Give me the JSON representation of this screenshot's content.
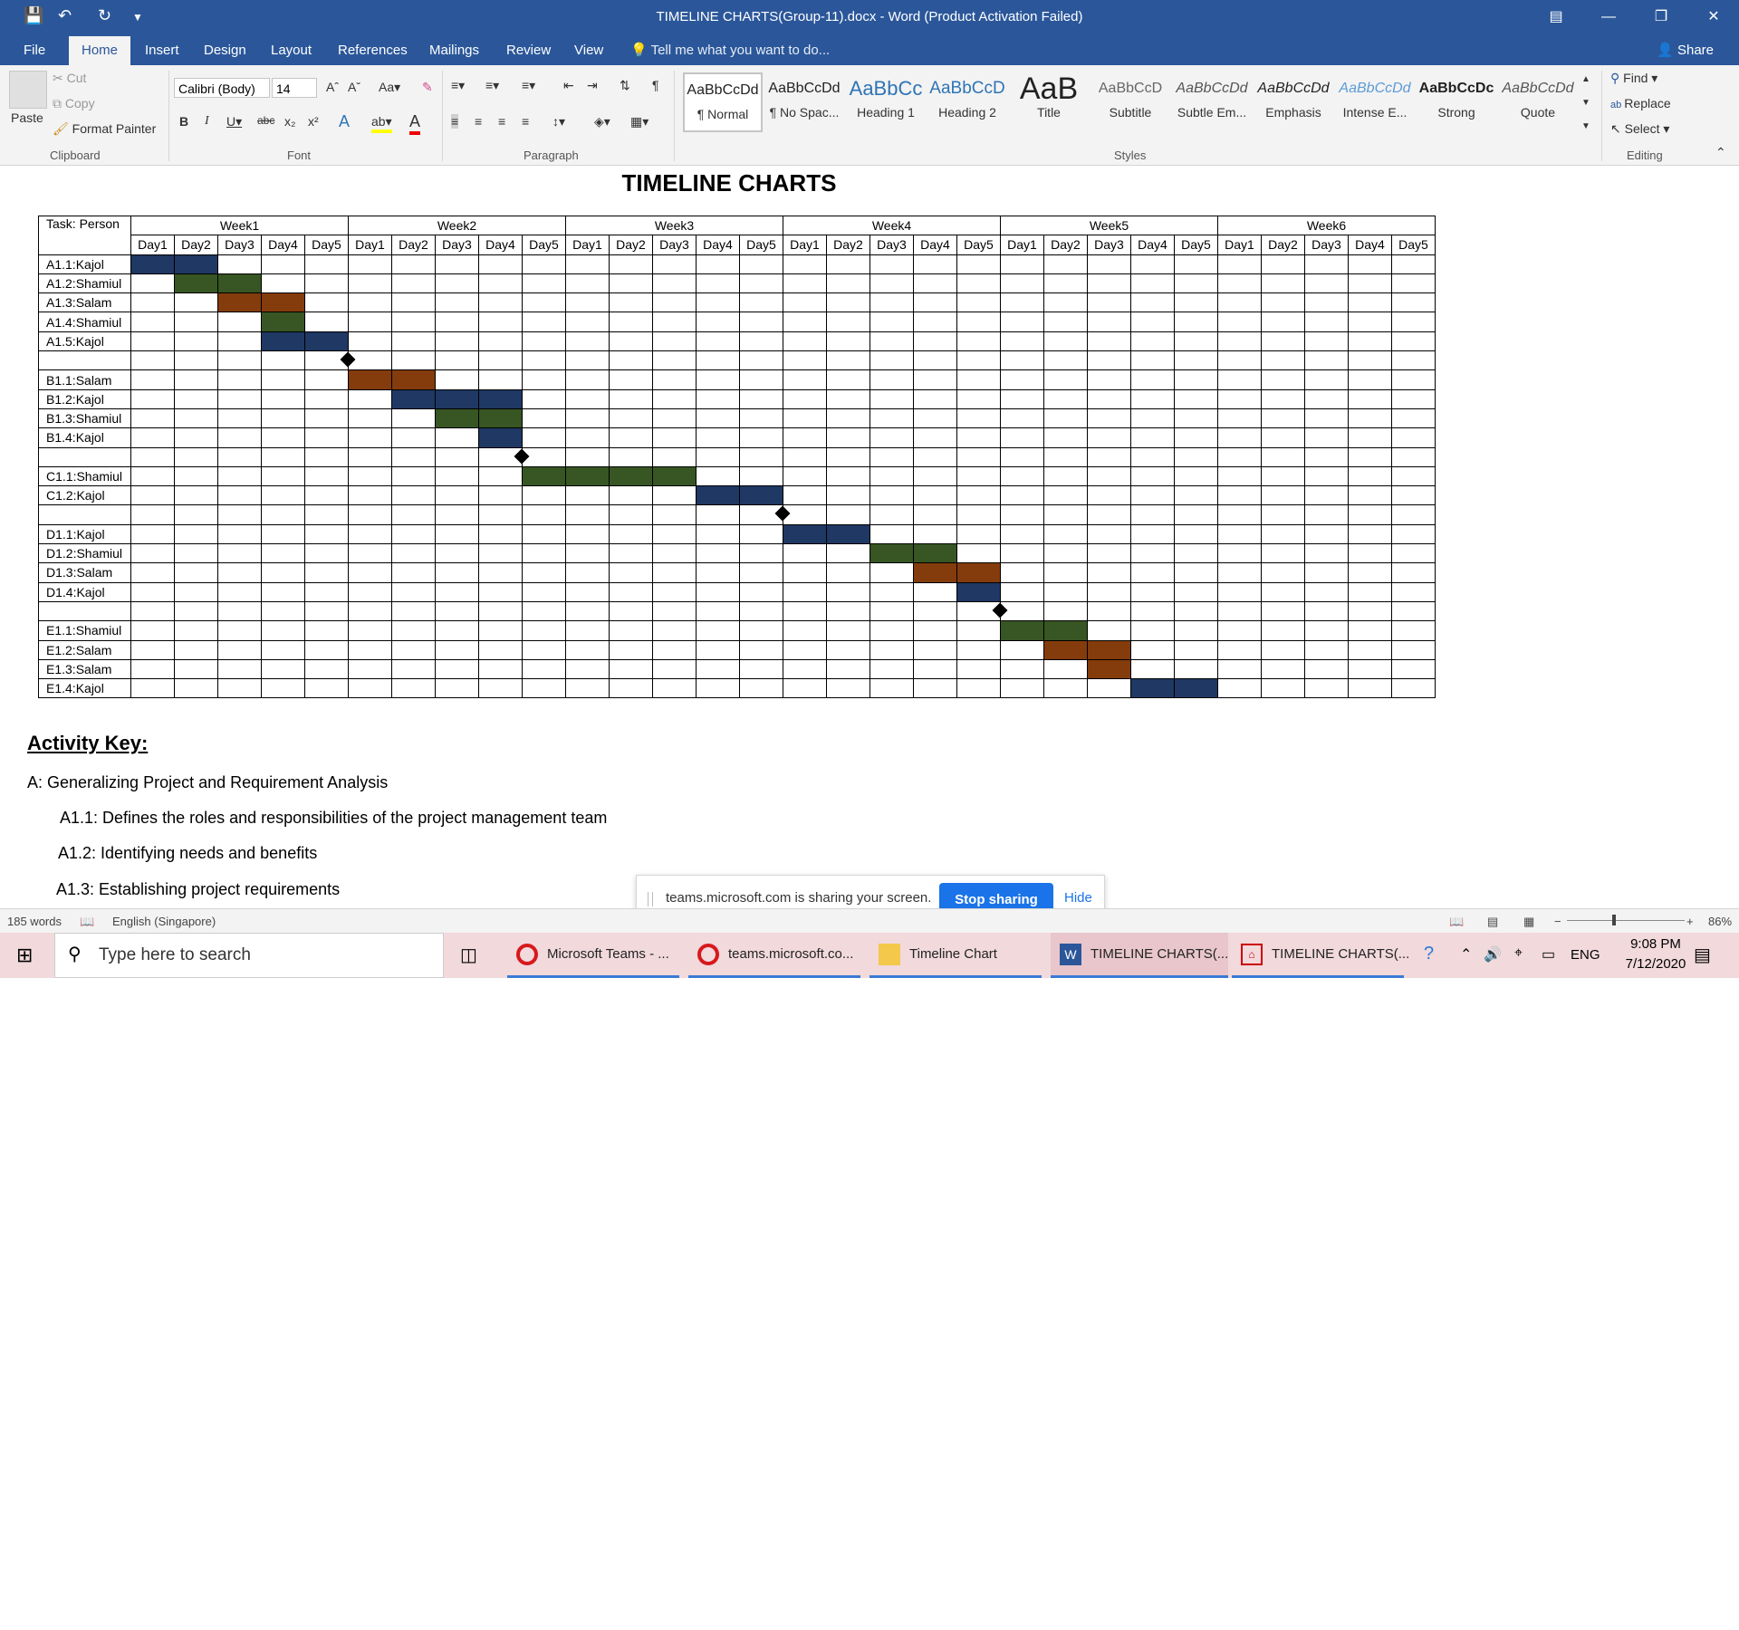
{
  "window": {
    "title": "TIMELINE CHARTS(Group-11).docx - Word (Product Activation Failed)"
  },
  "tabs": [
    "File",
    "Home",
    "Insert",
    "Design",
    "Layout",
    "References",
    "Mailings",
    "Review",
    "View"
  ],
  "tell_me": "Tell me what you want to do...",
  "share": "Share",
  "clipboard": {
    "paste": "Paste",
    "cut": "Cut",
    "copy": "Copy",
    "format_painter": "Format Painter",
    "label": "Clipboard"
  },
  "font": {
    "name": "Calibri (Body)",
    "size": "14",
    "label": "Font"
  },
  "paragraph": {
    "label": "Paragraph"
  },
  "styles": {
    "label": "Styles",
    "items": [
      {
        "preview": "AaBbCcDd",
        "name": "¶ Normal"
      },
      {
        "preview": "AaBbCcDd",
        "name": "¶ No Spac..."
      },
      {
        "preview": "AaBbCc",
        "name": "Heading 1"
      },
      {
        "preview": "AaBbCcD",
        "name": "Heading 2"
      },
      {
        "preview": "AaB",
        "name": "Title"
      },
      {
        "preview": "AaBbCcD",
        "name": "Subtitle"
      },
      {
        "preview": "AaBbCcDd",
        "name": "Subtle Em..."
      },
      {
        "preview": "AaBbCcDd",
        "name": "Emphasis"
      },
      {
        "preview": "AaBbCcDd",
        "name": "Intense E..."
      },
      {
        "preview": "AaBbCcDc",
        "name": "Strong"
      },
      {
        "preview": "AaBbCcDd",
        "name": "Quote"
      }
    ]
  },
  "editing": {
    "find": "Find",
    "replace": "Replace",
    "select": "Select",
    "label": "Editing"
  },
  "document": {
    "title": "TIMELINE CHARTS",
    "activity_key": "Activity Key:",
    "paragraphs": [
      "A: Generalizing Project and Requirement Analysis",
      "A1.1: Defines the roles and responsibilities of the project management team",
      "A1.2: Identifying needs and benefits",
      "A1.3: Establishing project requirements"
    ]
  },
  "colors": {
    "kajol": "#1f3864",
    "shamiul": "#375623",
    "salam": "#843c0c"
  },
  "chart_data": {
    "type": "table",
    "header_label": "Task: Person",
    "weeks": [
      "Week1",
      "Week2",
      "Week3",
      "Week4",
      "Week5",
      "Week6"
    ],
    "days": [
      "Day1",
      "Day2",
      "Day3",
      "Day4",
      "Day5"
    ],
    "rows": [
      {
        "task": "A1.1:Kajol",
        "start": 1,
        "end": 2,
        "person": "kajol"
      },
      {
        "task": "A1.2:Shamiul",
        "start": 2,
        "end": 3,
        "person": "shamiul"
      },
      {
        "task": "A1.3:Salam",
        "start": 3,
        "end": 4,
        "person": "salam"
      },
      {
        "task": "A1.4:Shamiul",
        "start": 4,
        "end": 4,
        "person": "shamiul"
      },
      {
        "task": "A1.5:Kajol",
        "start": 4,
        "end": 5,
        "person": "kajol"
      },
      {
        "task": "",
        "milestone": 6
      },
      {
        "task": "B1.1:Salam",
        "start": 6,
        "end": 7,
        "person": "salam"
      },
      {
        "task": "B1.2:Kajol",
        "start": 7,
        "end": 9,
        "person": "kajol"
      },
      {
        "task": "B1.3:Shamiul",
        "start": 8,
        "end": 9,
        "person": "shamiul"
      },
      {
        "task": "B1.4:Kajol",
        "start": 9,
        "end": 9,
        "person": "kajol"
      },
      {
        "task": "",
        "milestone": 10
      },
      {
        "task": "C1.1:Shamiul",
        "start": 10,
        "end": 13,
        "person": "shamiul"
      },
      {
        "task": "C1.2:Kajol",
        "start": 14,
        "end": 15,
        "person": "kajol"
      },
      {
        "task": "",
        "milestone": 16
      },
      {
        "task": "D1.1:Kajol",
        "start": 16,
        "end": 17,
        "person": "kajol"
      },
      {
        "task": "D1.2:Shamiul",
        "start": 18,
        "end": 19,
        "person": "shamiul"
      },
      {
        "task": "D1.3:Salam",
        "start": 19,
        "end": 20,
        "person": "salam"
      },
      {
        "task": "D1.4:Kajol",
        "start": 20,
        "end": 20,
        "person": "kajol"
      },
      {
        "task": "",
        "milestone": 21
      },
      {
        "task": "E1.1:Shamiul",
        "start": 21,
        "end": 22,
        "person": "shamiul"
      },
      {
        "task": "E1.2:Salam",
        "start": 22,
        "end": 23,
        "person": "salam"
      },
      {
        "task": "E1.3:Salam",
        "start": 23,
        "end": 23,
        "person": "salam"
      },
      {
        "task": "E1.4:Kajol",
        "start": 24,
        "end": 25,
        "person": "kajol"
      }
    ]
  },
  "share_banner": {
    "message": "teams.microsoft.com is sharing your screen.",
    "stop": "Stop sharing",
    "hide": "Hide"
  },
  "statusbar": {
    "words": "185 words",
    "language": "English (Singapore)",
    "zoom": "86%"
  },
  "taskbar": {
    "search_placeholder": "Type here to search",
    "items": [
      "Microsoft Teams - ...",
      "teams.microsoft.co...",
      "Timeline Chart",
      "TIMELINE CHARTS(...",
      "TIMELINE CHARTS(..."
    ],
    "lang": "ENG",
    "time": "9:08 PM",
    "date": "7/12/2020"
  }
}
